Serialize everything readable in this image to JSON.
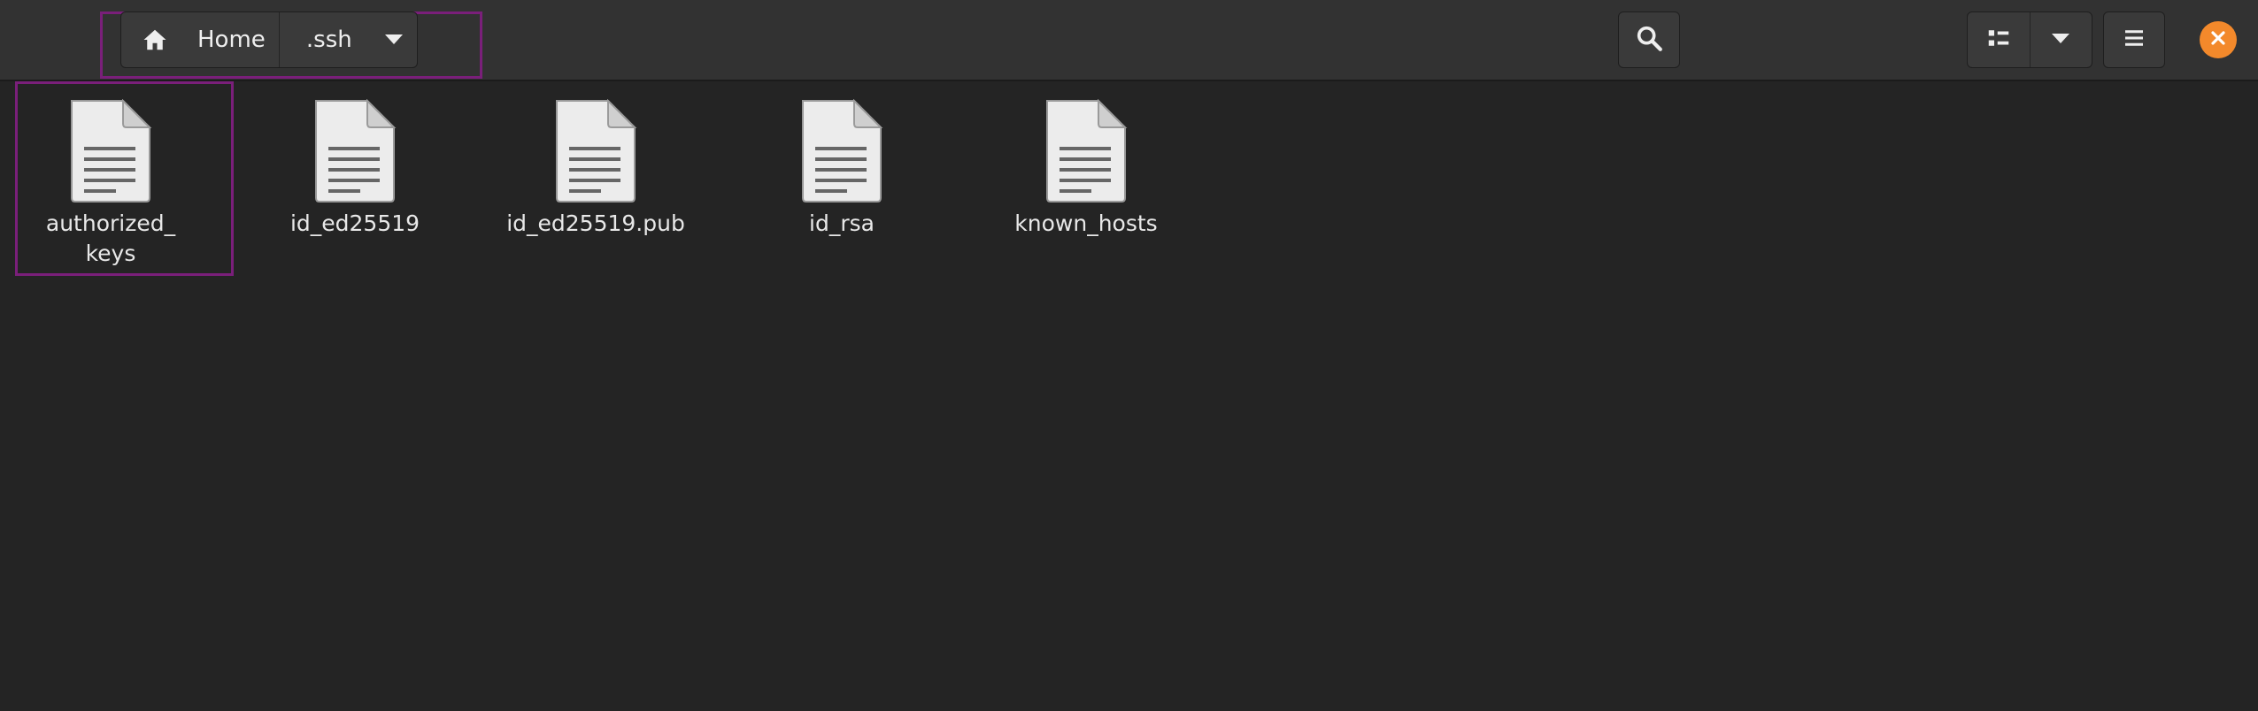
{
  "pathbar": {
    "home_label": "Home",
    "current_label": ".ssh"
  },
  "toolbar": {
    "search_icon": "search-icon",
    "view_icon": "list-view-icon",
    "view_options_icon": "chevron-down-icon",
    "menu_icon": "hamburger-menu-icon",
    "close_icon": "close-icon"
  },
  "colors": {
    "background": "#242424",
    "headerbar": "#323232",
    "focus": "#7a1f7a",
    "close": "#f3892b"
  },
  "files": [
    {
      "name": "authorized_\nkeys",
      "full_name": "authorized_keys",
      "icon": "text-file-icon",
      "selected": true
    },
    {
      "name": "id_ed25519",
      "icon": "text-file-icon",
      "selected": false
    },
    {
      "name": "id_ed25519.pub",
      "icon": "text-file-icon",
      "selected": false
    },
    {
      "name": "id_rsa",
      "icon": "text-file-icon",
      "selected": false
    },
    {
      "name": "known_hosts",
      "icon": "text-file-icon",
      "selected": false
    }
  ]
}
